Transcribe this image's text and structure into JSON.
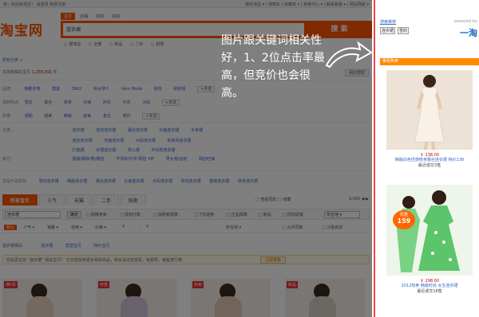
{
  "page": {
    "topbar_left": "亲，欢迎来淘宝！ 请登录 免费注册",
    "topbar_right": "我的淘宝 ▾ | 购物车 | 收藏夹 ▾ | 卖家中心 ▾ | 联系客服 ▾ | 网站导航 ▾",
    "logo": "淘宝网",
    "search_tabs": [
      "宝贝",
      "店铺",
      "淘吧",
      "拍拍"
    ],
    "search_value": "连衣裙",
    "search_button": "搜 索",
    "search_scopes": [
      "搜淘宝",
      "全部",
      "新品",
      "二手",
      "抢购"
    ],
    "crumb": "所有分类 >",
    "found_prefix": "共找到相关宝贝",
    "found_count": "1,258,391",
    "found_suffix": "件",
    "util_button": "网店帮助",
    "filter_rows": [
      {
        "label": "品牌:",
        "items": [
          "韩都衣舍",
          "茵曼",
          "ONLY",
          "秋水伊人",
          "Vero Moda",
          "裂帛",
          "歌莉娅"
        ],
        "more": "+多选"
      },
      {
        "label": "选购热点:",
        "items": [
          "雪纺",
          "蕾丝",
          "修身",
          "长袖",
          "碎花",
          "印花",
          "大码"
        ],
        "more": "+多选"
      },
      {
        "label": "风格:",
        "items": [
          "通勤",
          "甜美",
          "韩版",
          "欧美",
          "复古",
          "简约"
        ],
        "more": "+多选"
      }
    ],
    "filter_rows2": [
      {
        "label": "分类:",
        "items": [
          "连衣裙",
          "雪纺连衣裙",
          "蕾丝连衣裙",
          "长袖连衣裙",
          "半身裙"
        ]
      },
      {
        "label": "",
        "items": [
          "真丝连衣裙",
          "无袖连衣裙",
          "大码连衣裙",
          "民族风连衣裙"
        ]
      },
      {
        "label": "",
        "items": [
          "打底裙",
          "长裙连衣裙",
          "背心裙",
          "中长款连衣裙"
        ]
      },
      {
        "label": "其它:",
        "items": [
          "服装/服饰/鞋/箱包",
          "字母标/印字/网店 VIP",
          "男女装/运动",
          "网店旺铺"
        ]
      }
    ],
    "recommend_label": "您是不是想找:",
    "recommend_items": [
      "雪纺连衣裙",
      "韩版连衣裙",
      "蕾丝连衣裙",
      "长袖连衣裙",
      "大码连衣裙",
      "碎花连衣裙",
      "春装连衣裙",
      "修身连衣裙"
    ],
    "result_tabs": [
      "所有宝贝",
      "人气",
      "天猫",
      "二手",
      "拍卖"
    ],
    "result_check": "□ 查看同款  □ 收藏",
    "pager": "1/100 ◀ ▶",
    "filter_input": "连衣裙",
    "filter_go": "确定",
    "filter_checks": [
      "保障卖家",
      "货到付款",
      "消费者保障",
      "7天退换",
      "正品保障",
      "新品",
      "折扣促销"
    ],
    "filter_select": "所在地 ▾",
    "sort_items": [
      "默认",
      "人气 ▾",
      "销量 ▾",
      "信用 ▾",
      "价格 ▾",
      "¥",
      "-",
      "¥",
      "所在地 ▾",
      "□ 合并同款",
      "□ 只看有货"
    ],
    "related_label": "连衣裙相关:",
    "related_items": [
      "连衣裙",
      "直营宝贝",
      "特价宝贝"
    ],
    "tip_text": "您是否在找 “连衣裙” 相关宝贝？ 已为您找到更多相关商品，购买请点击查看，免邮费，销售排行榜",
    "tip_button": "立即查看",
    "thumb_badges": [
      "满5折",
      "特惠",
      "热卖",
      "新品"
    ],
    "overlay_note": "图片跟关键词相关性好，1、2位点击率最高，但竞价也会很高。",
    "ad": {
      "hint": "搜索推荐",
      "powered": "powered by",
      "tags": [
        "连衣裙",
        "雪纺"
      ],
      "logo": "一淘",
      "heading": "掌柜热卖",
      "products": [
        {
          "price": "￥ 138.00",
          "title": "韩版白色性感修身蕾丝连衣裙",
          "title_em": "连衣裙",
          "title_suffix": " 特价138",
          "sold": "最近成交3笔"
        },
        {
          "price": "￥ 298.00",
          "title": "2012热卖 韩版时尚 女生连衣裙",
          "title_em": "连衣",
          "title_suffix": "",
          "sold": "最近成交18笔",
          "ribbon_top": "优雅",
          "ribbon_mid": "时尚",
          "ribbon_price": "159"
        }
      ]
    }
  }
}
